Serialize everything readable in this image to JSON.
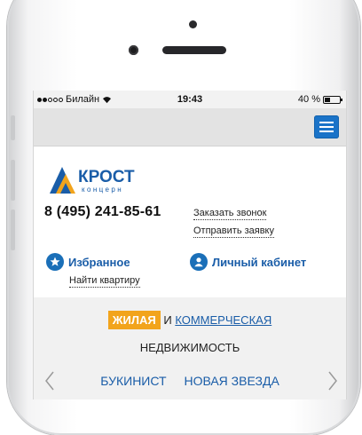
{
  "status_bar": {
    "carrier": "Билайн",
    "time": "19:43",
    "battery_percent": "40 %",
    "battery_level": 0.4
  },
  "navbar": {
    "menu_icon": "hamburger-icon",
    "accent_color": "#1a73c8"
  },
  "header": {
    "logo_text": "КРОСТ",
    "logo_subtext": "концерн",
    "phone": "8 (495) 241-85-61",
    "order_call": "Заказать звонок",
    "send_request": "Отправить заявку",
    "favorites": "Избранное",
    "find_apartment": "Найти квартиру",
    "cabinet": "Личный кабинет"
  },
  "property_type": {
    "residential": "ЖИЛАЯ",
    "conjunction": "И",
    "commercial": "КОММЕРЧЕСКАЯ",
    "realty": "НЕДВИЖИМОСТЬ"
  },
  "carousel": {
    "items": [
      "БУКИНИСТ",
      "НОВАЯ ЗВЕЗДА"
    ],
    "prev_icon": "chevron-left-icon",
    "next_icon": "chevron-right-icon"
  }
}
